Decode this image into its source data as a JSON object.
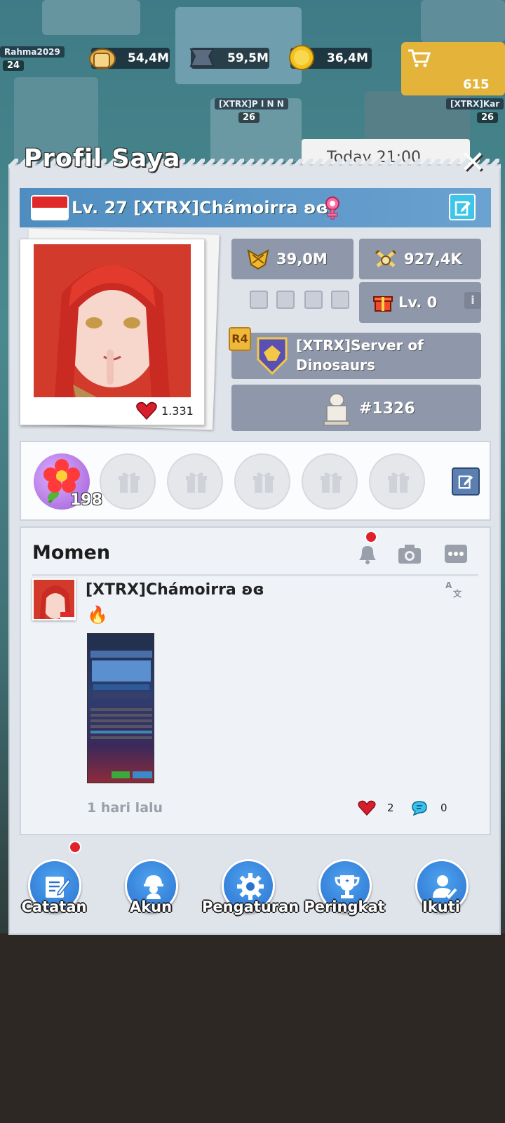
{
  "map": {
    "player_label": "Rahma2029",
    "player_level": "24",
    "resources": [
      {
        "icon": "bread-icon",
        "value": "54,4M"
      },
      {
        "icon": "iron-icon",
        "value": "59,5M"
      },
      {
        "icon": "gold-coin-icon",
        "value": "36,4M"
      }
    ],
    "base_labels": [
      {
        "name": "[XTRX]P I N N",
        "level": "26"
      },
      {
        "name": "[XTRX]Kar",
        "level": "26"
      }
    ],
    "shop_count": "615",
    "partial_text": "Today 21:00"
  },
  "modal": {
    "title": "Profil Saya",
    "close_icon": "close-icon"
  },
  "profile": {
    "flag": "Indonesia",
    "name_line": "Lv. 27 [XTRX]Chámoirra ʚɞ",
    "likes": "1.331",
    "power": "39,0M",
    "kills": "927,4K",
    "gift_level": "Lv. 0",
    "rank_badge": "R4",
    "alliance": "[XTRX]Server of Dinosaurs",
    "ranking": "#1326"
  },
  "gifts": {
    "flower_count": "198",
    "slots": 5
  },
  "moments": {
    "title": "Momen",
    "post": {
      "author": "[XTRX]Chámoirra ʚɞ",
      "emoji": "🔥",
      "time": "1 hari lalu",
      "likes": "2",
      "comments": "0"
    }
  },
  "nav": [
    {
      "label": "Catatan",
      "icon": "notes-icon",
      "badge": true
    },
    {
      "label": "Akun",
      "icon": "account-icon",
      "badge": false
    },
    {
      "label": "Pengaturan",
      "icon": "settings-gear-icon",
      "badge": false
    },
    {
      "label": "Peringkat",
      "icon": "trophy-icon",
      "badge": false
    },
    {
      "label": "Ikuti",
      "icon": "follow-icon",
      "badge": false
    }
  ],
  "colors": {
    "name_bar": "#5a96c8",
    "stat_box": "#8f98aa",
    "nav_blue": "#2b73d0",
    "badge_red": "#e0202a"
  }
}
